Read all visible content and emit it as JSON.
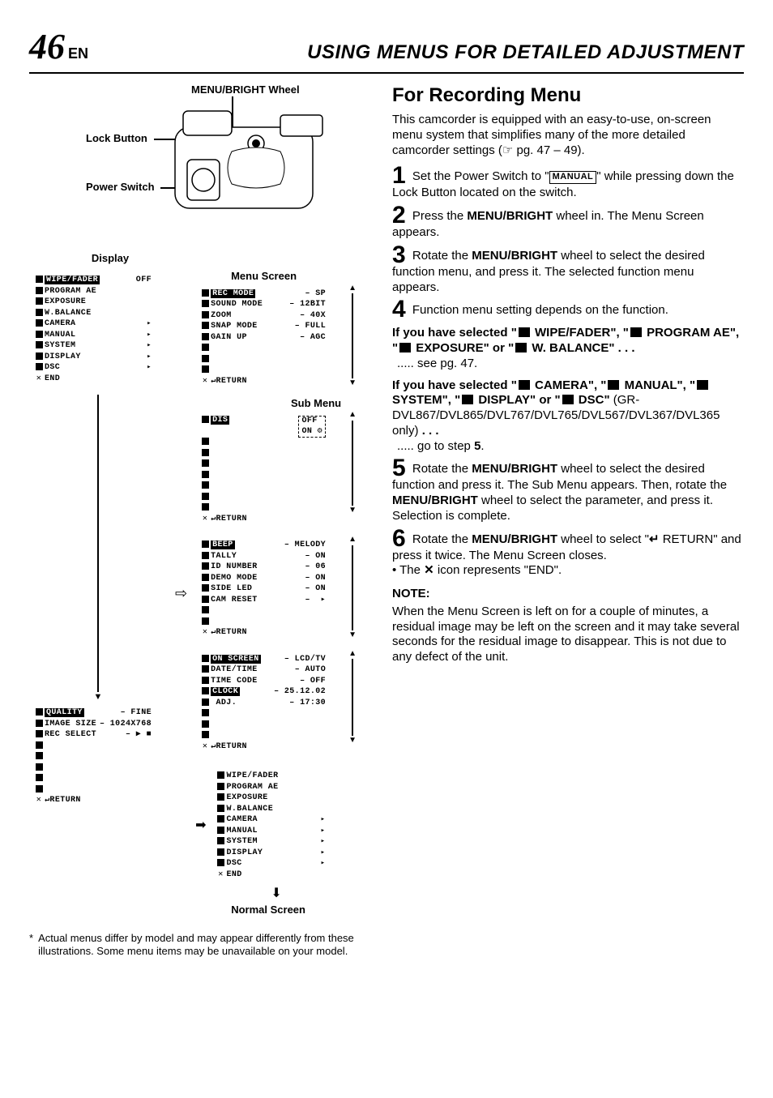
{
  "header": {
    "page_number": "46",
    "lang_suffix": "EN",
    "title": "USING MENUS FOR DETAILED ADJUSTMENT"
  },
  "left": {
    "callouts": {
      "menu_bright": "MENU/BRIGHT Wheel",
      "lock_button": "Lock Button",
      "power_switch": "Power Switch"
    },
    "display_label": "Display",
    "menu_screen_label": "Menu Screen",
    "sub_menu_label": "Sub Menu",
    "normal_screen_label": "Normal Screen",
    "main_menu": {
      "rows": [
        {
          "icon": "sq",
          "label": "WIPE/FADER",
          "val": "OFF",
          "hl": true
        },
        {
          "icon": "sq",
          "label": "PROGRAM AE",
          "val": ""
        },
        {
          "icon": "sq",
          "label": "EXPOSURE",
          "val": ""
        },
        {
          "icon": "sq",
          "label": "W.BALANCE",
          "val": ""
        },
        {
          "icon": "sq",
          "label": "CAMERA",
          "val": "",
          "arrow": true
        },
        {
          "icon": "sq",
          "label": "MANUAL",
          "val": "",
          "arrow": true
        },
        {
          "icon": "sq",
          "label": "SYSTEM",
          "val": "",
          "arrow": true
        },
        {
          "icon": "sq",
          "label": "DISPLAY",
          "val": "",
          "arrow": true
        },
        {
          "icon": "sq",
          "label": "DSC",
          "val": "",
          "arrow": true
        },
        {
          "icon": "x",
          "label": "END",
          "val": ""
        }
      ]
    },
    "camera_menu": {
      "rows": [
        {
          "label": "REC MODE",
          "val": "SP",
          "hl": true
        },
        {
          "label": "SOUND MODE",
          "val": "12BIT"
        },
        {
          "label": "ZOOM",
          "val": "40X"
        },
        {
          "label": "SNAP MODE",
          "val": "FULL"
        },
        {
          "label": "GAIN UP",
          "val": "AGC"
        }
      ],
      "return": "RETURN"
    },
    "dis_menu": {
      "title": "DIS",
      "options": [
        "OFF",
        "ON"
      ],
      "return": "RETURN"
    },
    "system_menu": {
      "rows": [
        {
          "label": "BEEP",
          "val": "MELODY",
          "hl": true
        },
        {
          "label": "TALLY",
          "val": "ON"
        },
        {
          "label": "ID NUMBER",
          "val": "06"
        },
        {
          "label": "DEMO MODE",
          "val": "ON"
        },
        {
          "label": "SIDE LED",
          "val": "ON"
        },
        {
          "label": "CAM RESET",
          "val": "",
          "arrow": true
        }
      ],
      "return": "RETURN"
    },
    "display_menu": {
      "rows": [
        {
          "label": "ON SCREEN",
          "val": "LCD/TV",
          "hl": true
        },
        {
          "label": "DATE/TIME",
          "val": "AUTO"
        },
        {
          "label": "TIME CODE",
          "val": "OFF"
        },
        {
          "label": "CLOCK",
          "val": "25.12.02",
          "hlrow": true
        },
        {
          "label": " ADJ.",
          "val": "17:30"
        }
      ],
      "return": "RETURN"
    },
    "dsc_menu": {
      "rows": [
        {
          "label": "QUALITY",
          "val": "FINE",
          "hl": true
        },
        {
          "label": "IMAGE SIZE",
          "val": "1024X768"
        },
        {
          "label": "REC SELECT",
          "val": "▶ ■"
        }
      ],
      "return": "RETURN"
    },
    "return_menu": {
      "rows": [
        {
          "icon": "sq",
          "label": "WIPE/FADER"
        },
        {
          "icon": "sq",
          "label": "PROGRAM AE"
        },
        {
          "icon": "sq",
          "label": "EXPOSURE"
        },
        {
          "icon": "sq",
          "label": "W.BALANCE"
        },
        {
          "icon": "sq",
          "label": "CAMERA",
          "arrow": true
        },
        {
          "icon": "sq",
          "label": "MANUAL",
          "arrow": true
        },
        {
          "icon": "sq",
          "label": "SYSTEM",
          "arrow": true
        },
        {
          "icon": "sq",
          "label": "DISPLAY",
          "arrow": true
        },
        {
          "icon": "sq",
          "label": "DSC",
          "arrow": true
        },
        {
          "icon": "x",
          "label": "END"
        }
      ]
    },
    "footnote": "Actual menus differ by model and may appear differently from these illustrations. Some menu items may be unavailable on your model."
  },
  "right": {
    "heading": "For Recording Menu",
    "intro": "This camcorder is equipped with an easy-to-use, on-screen menu system that simplifies many of the more detailed camcorder settings (☞ pg. 47 – 49).",
    "steps": {
      "s1_a": "Set the Power Switch to \"",
      "s1_badge": "MANUAL",
      "s1_b": "\" while pressing down the Lock Button located on the switch.",
      "s2_a": "Press the ",
      "s2_b": "MENU/BRIGHT",
      "s2_c": " wheel in. The Menu Screen appears.",
      "s3_a": "Rotate the ",
      "s3_b": "MENU/BRIGHT",
      "s3_c": " wheel to select the desired function menu, and press it. The selected function menu appears.",
      "s4": "Function menu setting depends on the function.",
      "selA_1": "If you have selected \"",
      "selA_wipe": " WIPE/FADER\", \"",
      "selA_prog": " PROGRAM AE\", \"",
      "selA_exp": " EXPOSURE\" or \"",
      "selA_wb": " W. BALANCE\" . . .",
      "selA_act": " ..... see pg. 47.",
      "selB_1": "If you have selected \"",
      "selB_cam": " CAMERA\", \"",
      "selB_man": " MANUAL\", \"",
      "selB_sys": " SYSTEM\", \"",
      "selB_disp": " DISPLAY\" or \"",
      "selB_dsc": " DSC\"",
      "selB_models": " (GR-DVL867/DVL865/DVL767/DVL765/DVL567/DVL367/DVL365 only) ",
      "selB_dots": ". . .",
      "selB_act_a": " ..... go to step ",
      "selB_act_b": "5",
      "selB_act_c": ".",
      "s5_a": "Rotate the ",
      "s5_b": "MENU/BRIGHT",
      "s5_c": " wheel to select the desired function and press it. The Sub Menu appears. Then, rotate the ",
      "s5_d": "MENU/BRIGHT",
      "s5_e": " wheel to select the parameter, and press it. Selection is complete.",
      "s6_a": "Rotate the ",
      "s6_b": "MENU/BRIGHT",
      "s6_c": " wheel to select \"",
      "s6_ret": " RETURN\" and press it twice. The Menu Screen closes.",
      "s6_bullet": "• The ",
      "s6_bullet2": " icon represents \"END\"."
    },
    "note_h": "NOTE:",
    "note_body": "When the Menu Screen is left on for a couple of minutes, a residual image may be left on the screen and it may take several seconds for the residual image to disappear. This is not due to any defect of the unit."
  }
}
